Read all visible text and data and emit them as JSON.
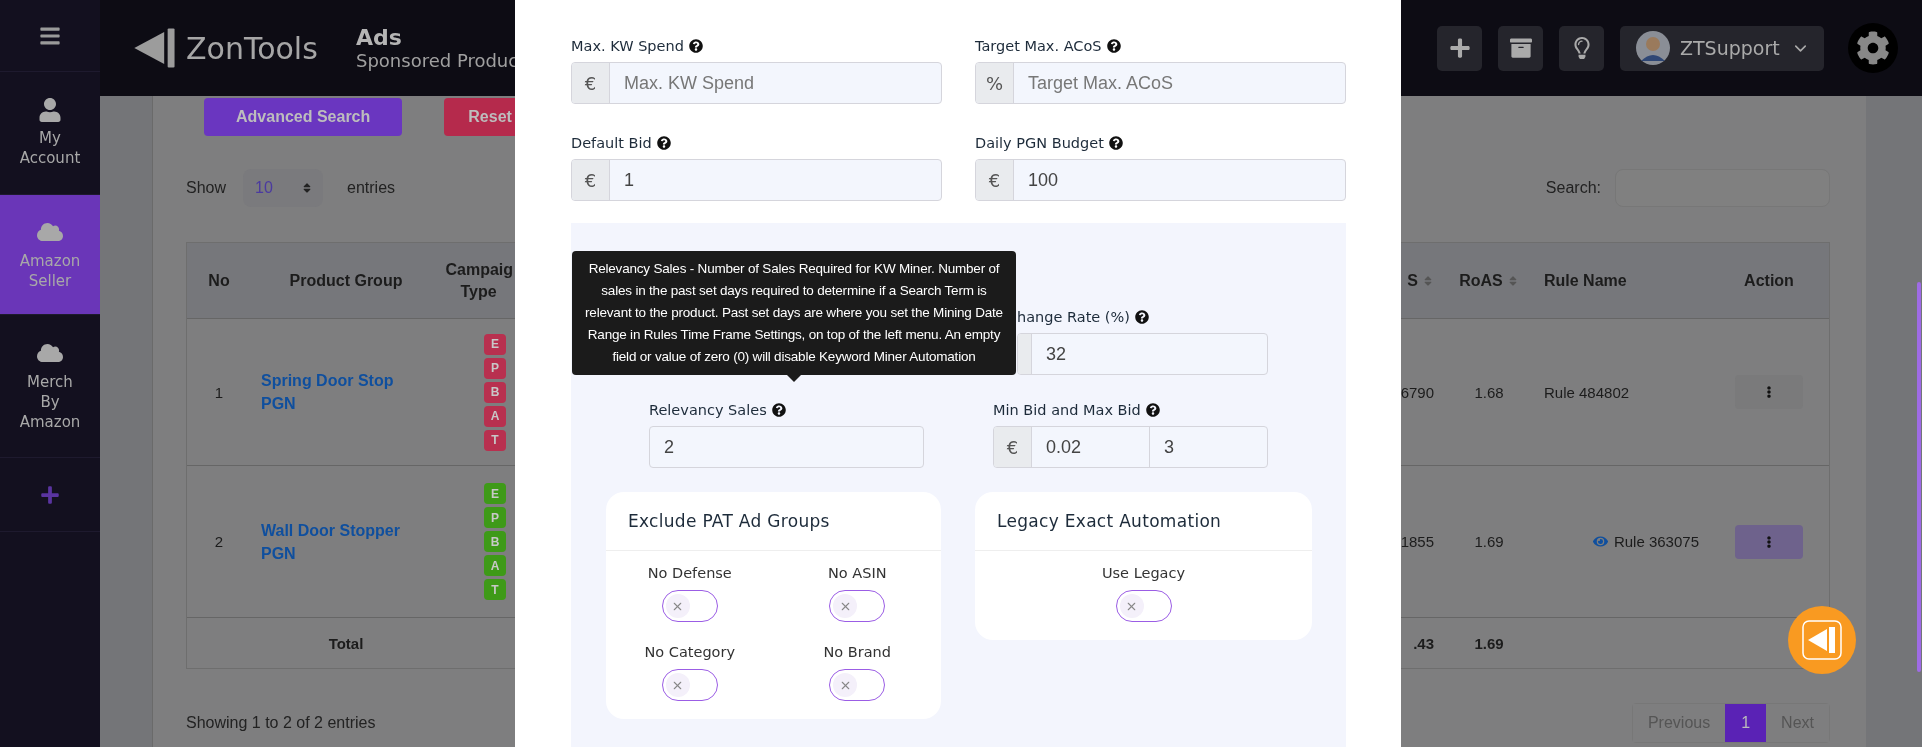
{
  "sidebar": {
    "items": [
      {
        "label": "My Account",
        "selected": false
      },
      {
        "label": "Amazon Seller",
        "selected": true
      },
      {
        "label": "Merch By Amazon",
        "selected": false
      }
    ]
  },
  "header": {
    "logo": "ZonTools",
    "title": "Ads",
    "subtitle": "Sponsored Produc",
    "user": "ZTSupport"
  },
  "toolbar": {
    "buttons": [
      {
        "label": "Advanced Search",
        "kind": "primary"
      },
      {
        "label": "Reset",
        "kind": "danger"
      }
    ]
  },
  "length_menu": {
    "before": "Show",
    "value": "10",
    "after": "entries"
  },
  "search": {
    "label": "Search:"
  },
  "table": {
    "columns": [
      {
        "label": "No",
        "sortable": false
      },
      {
        "label": "Product Group",
        "sortable": false
      },
      {
        "label": "Campaig Type",
        "sortable": false
      },
      {
        "label": "S",
        "sortable": true
      },
      {
        "label": "RoAS",
        "sortable": true
      },
      {
        "label": "Rule Name",
        "sortable": false
      },
      {
        "label": "Action",
        "sortable": false
      }
    ],
    "rows": [
      {
        "no": "1",
        "product_group": "Spring Door Stop PGN",
        "badges": [
          {
            "label": "E",
            "color": "#b8304f"
          },
          {
            "label": "P",
            "color": "#b8304f"
          },
          {
            "label": "B",
            "color": "#b8304f"
          },
          {
            "label": "A",
            "color": "#b8304f"
          },
          {
            "label": "T",
            "color": "#b8304f"
          }
        ],
        "column_4": "6790",
        "roas": "1.68",
        "rule": "Rule 484802",
        "kind": "plain",
        "action_active": false
      },
      {
        "no": "2",
        "product_group": "Wall Door Stopper PGN",
        "badges": [
          {
            "label": "E",
            "color": "#3e9a18"
          },
          {
            "label": "P",
            "color": "#3e9a18"
          },
          {
            "label": "B",
            "color": "#3e9a18"
          },
          {
            "label": "A",
            "color": "#3e9a18"
          },
          {
            "label": "T",
            "color": "#3e9a18"
          }
        ],
        "column_4": "1855",
        "roas": "1.69",
        "rule": "Rule 363075",
        "kind": "viewed",
        "action_active": true
      }
    ],
    "total": {
      "label": "Total",
      "column_4": ".43",
      "roas": "1.69"
    }
  },
  "info": "Showing 1 to 2 of 2 entries",
  "pagination": [
    {
      "label": "Previous",
      "kind": "nav",
      "selected": false
    },
    {
      "label": "1",
      "kind": "page",
      "selected": true
    },
    {
      "label": "Next",
      "kind": "nav",
      "selected": false
    }
  ],
  "modal": {
    "fields": [
      {
        "label": "Max. KW Spend",
        "prefix": "€",
        "placeholder": "Max. KW Spend"
      },
      {
        "label": "Target Max. ACoS",
        "prefix": "%",
        "placeholder": "Target Max. ACoS"
      },
      {
        "label": "Default Bid",
        "prefix": "€",
        "value": "1"
      },
      {
        "label": "Daily PGN Budget",
        "prefix": "€",
        "value": "100"
      }
    ],
    "automation": {
      "fields": [
        {
          "label": "hange Rate (%)",
          "value": "32",
          "kind": "covered"
        },
        {
          "label": "Relevancy Sales",
          "value": "2",
          "kind": "plain"
        },
        {
          "label": "Min Bid and Max Bid",
          "prefix": "€",
          "value": "0.02",
          "value_2": "3",
          "kind": "range"
        }
      ],
      "tooltip": "Relevancy Sales - Number of Sales Required for KW Miner. Number of sales in the past set days required to determine if a Search Term is relevant to the product. Past set days are where you set the Mining Date Range in Rules Time Frame Settings, on top of the left menu. An empty field or value of zero (0) will disable Keyword Miner Automation",
      "cards": [
        {
          "title": "Exclude PAT Ad Groups",
          "toggles": [
            {
              "label": "No Defense",
              "on": false
            },
            {
              "label": "No ASIN",
              "on": false
            },
            {
              "label": "No Category",
              "on": false
            },
            {
              "label": "No Brand",
              "on": false
            }
          ]
        },
        {
          "title": "Legacy Exact Automation",
          "toggles": [
            {
              "label": "Use Legacy",
              "on": false
            }
          ]
        }
      ]
    }
  }
}
